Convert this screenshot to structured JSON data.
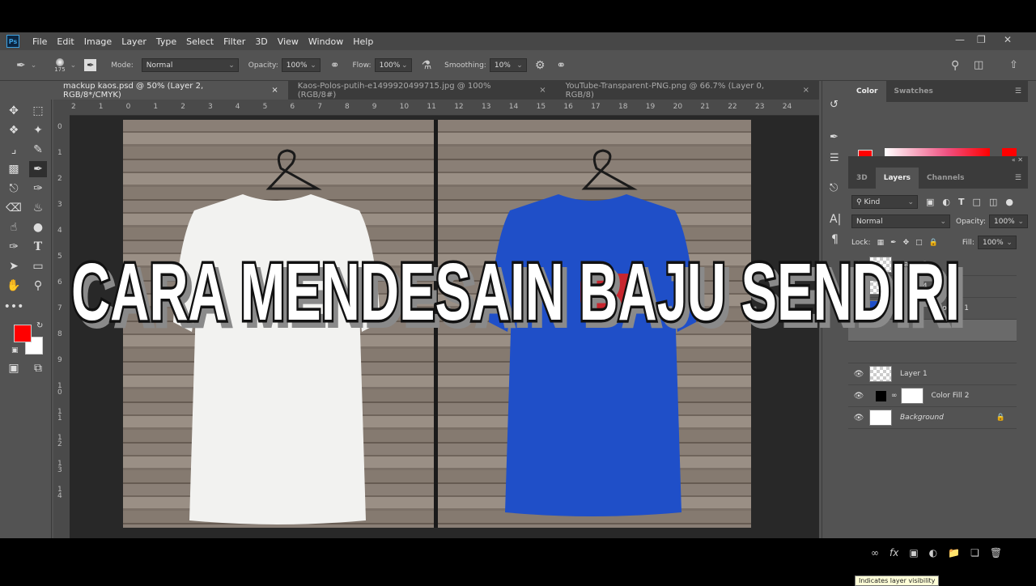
{
  "app": {
    "logo": "Ps",
    "menu": [
      "File",
      "Edit",
      "Image",
      "Layer",
      "Type",
      "Select",
      "Filter",
      "3D",
      "View",
      "Window",
      "Help"
    ],
    "window_controls": [
      "minimize",
      "restore",
      "close"
    ]
  },
  "options": {
    "brush_size": "175",
    "mode_label": "Mode:",
    "mode": "Normal",
    "opacity_label": "Opacity:",
    "opacity": "100%",
    "flow_label": "Flow:",
    "flow": "100%",
    "smoothing_label": "Smoothing:",
    "smoothing": "10%"
  },
  "tabs": [
    {
      "label": "mackup kaos.psd @ 50% (Layer 2, RGB/8*/CMYK)",
      "active": true
    },
    {
      "label": "Kaos-Polos-putih-e1499920499715.jpg @ 100% (RGB/8#)",
      "active": false
    },
    {
      "label": "YouTube-Transparent-PNG.png @ 66.7% (Layer 0, RGB/8)",
      "active": false
    }
  ],
  "ruler_h": [
    "2",
    "1",
    "0",
    "1",
    "2",
    "3",
    "4",
    "5",
    "6",
    "7",
    "8",
    "9",
    "10",
    "11",
    "12",
    "13",
    "14",
    "15",
    "16",
    "17",
    "18",
    "19",
    "20",
    "21",
    "22",
    "23",
    "24"
  ],
  "ruler_v": [
    "0",
    "1",
    "2",
    "3",
    "4",
    "5",
    "6",
    "7",
    "8",
    "9",
    "1 0",
    "1 1",
    "1 2",
    "1 3",
    "1 4"
  ],
  "colors": {
    "foreground": "#ff0000",
    "background": "#ffffff",
    "shirt_left": "#f2f2f0",
    "shirt_right": "#1f4fc8"
  },
  "color_panel": {
    "tabs": [
      "Color",
      "Swatches"
    ]
  },
  "layers_panel": {
    "tabs": [
      "3D",
      "Layers",
      "Channels"
    ],
    "filter": "Kind",
    "blend": "Normal",
    "opacity_label": "Opacity:",
    "opacity": "100%",
    "lock_label": "Lock:",
    "fill_label": "Fill:",
    "fill": "100%",
    "layers": [
      {
        "name": "Layer 3"
      },
      {
        "name": "Layer 4"
      },
      {
        "name": "Color Fill 1"
      },
      {
        "name": ""
      },
      {
        "name": ""
      },
      {
        "name": "Layer 1"
      },
      {
        "name": "Color Fill 2"
      },
      {
        "name": "Background"
      }
    ],
    "tooltip": "Indicates layer visibility"
  },
  "overlay_title": "CARA MENDESAIN BAJU SENDIRI"
}
